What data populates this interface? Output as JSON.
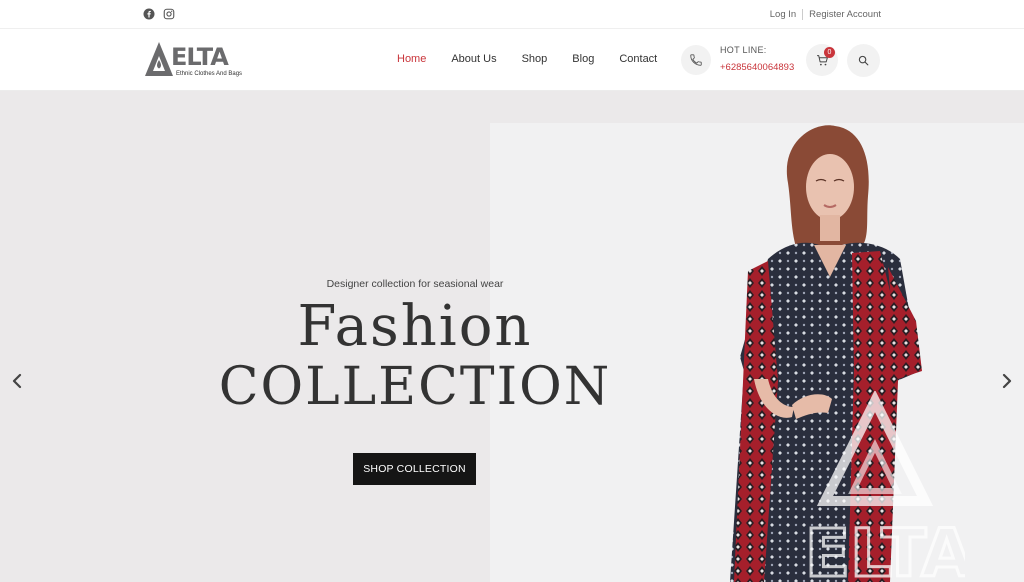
{
  "topbar": {
    "social_icons": [
      "facebook-icon",
      "instagram-icon"
    ],
    "login_label": "Log In",
    "register_label": "Register Account"
  },
  "header": {
    "logo": {
      "wordmark": "ELTA",
      "tagline": "Ethnic Clothes And Bags"
    },
    "nav": [
      {
        "label": "Home",
        "active": true
      },
      {
        "label": "About Us",
        "active": false
      },
      {
        "label": "Shop",
        "active": false
      },
      {
        "label": "Blog",
        "active": false
      },
      {
        "label": "Contact",
        "active": false
      }
    ],
    "hotline_label": "HOT LINE:",
    "hotline_number": "+6285640064893",
    "cart_count": "0",
    "icons": {
      "phone": "phone-icon",
      "cart": "cart-icon",
      "search": "search-icon"
    }
  },
  "hero": {
    "subtitle": "Designer collection for seasional wear",
    "title_line1": "Fashion",
    "title_line2": "COLLECTION",
    "cta_label": "SHOP COLLECTION",
    "watermark_text": "ELTA",
    "icons": {
      "prev": "chevron-left-icon",
      "next": "chevron-right-icon"
    }
  },
  "colors": {
    "accent": "#c9353b",
    "hero_bg": "#ebe9ea",
    "button_bg": "#151515",
    "text": "#333333"
  }
}
